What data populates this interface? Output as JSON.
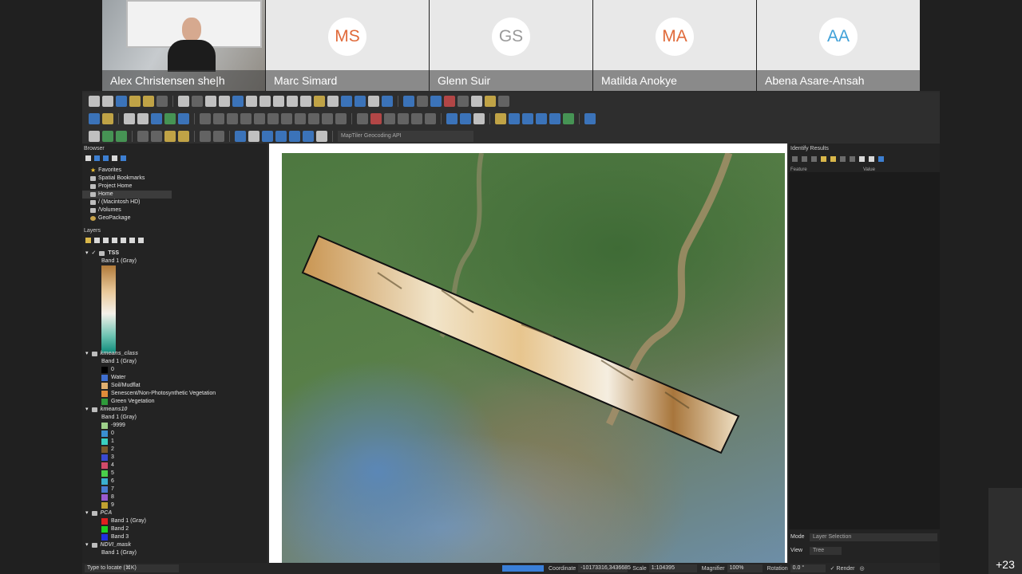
{
  "participants": [
    {
      "name": "Alex Christensen she|h",
      "initials": "",
      "video": true,
      "color": "#ffffff"
    },
    {
      "name": "Marc Simard",
      "initials": "MS",
      "video": false,
      "color": "#e06a3a"
    },
    {
      "name": "Glenn Suir",
      "initials": "GS",
      "video": false,
      "color": "#9a9a9a"
    },
    {
      "name": "Matilda Anokye",
      "initials": "MA",
      "video": false,
      "color": "#e06a3a"
    },
    {
      "name": "Abena Asare-Ansah",
      "initials": "AA",
      "video": false,
      "color": "#3ea0d8"
    }
  ],
  "more_participants": "+23",
  "toolbar": {
    "geocoding_placeholder": "MapTiler Geocoding API"
  },
  "browser": {
    "title": "Browser",
    "items": [
      "Favorites",
      "Spatial Bookmarks",
      "Project Home",
      "Home",
      "/ (Macintosh HD)",
      "/Volumes",
      "GeoPackage"
    ],
    "selected": "Home"
  },
  "layers": {
    "title": "Layers",
    "tss": {
      "name": "TSS",
      "band": "Band 1 (Gray)"
    },
    "kmeans_class": {
      "name": "kmeans_class",
      "band": "Band 1 (Gray)",
      "classes": [
        {
          "label": "0",
          "color": "#000000"
        },
        {
          "label": "Water",
          "color": "#3f6fd0"
        },
        {
          "label": "Soil/Mudflat",
          "color": "#e0b070"
        },
        {
          "label": "Senescent/Non-Photosynthetic Vegetation",
          "color": "#e08c3a"
        },
        {
          "label": "Green Vegetation",
          "color": "#2e9a3a"
        }
      ]
    },
    "kmeans10": {
      "name": "kmeans10",
      "band": "Band 1 (Gray)",
      "classes": [
        {
          "label": "-9999",
          "color": "#9ed08a"
        },
        {
          "label": "0",
          "color": "#3a8fd0"
        },
        {
          "label": "1",
          "color": "#3ad0c0"
        },
        {
          "label": "2",
          "color": "#7a5a2a"
        },
        {
          "label": "3",
          "color": "#3a4ad0"
        },
        {
          "label": "4",
          "color": "#d04a6a"
        },
        {
          "label": "5",
          "color": "#4ad04a"
        },
        {
          "label": "6",
          "color": "#3ab0d0"
        },
        {
          "label": "7",
          "color": "#4a7ad0"
        },
        {
          "label": "8",
          "color": "#9a5ad0"
        },
        {
          "label": "9",
          "color": "#c0a030"
        }
      ]
    },
    "pca": {
      "name": "PCA",
      "bands": [
        {
          "label": "Band 1 (Gray)",
          "color": "#e02020"
        },
        {
          "label": "Band 2",
          "color": "#20d020"
        },
        {
          "label": "Band 3",
          "color": "#2030e0"
        }
      ]
    },
    "ndvi_mask": {
      "name": "NDVI_mask",
      "band": "Band 1 (Gray)"
    }
  },
  "identify": {
    "title": "Identify Results",
    "col_feature": "Feature",
    "col_value": "Value",
    "mode_label": "Mode",
    "mode_value": "Layer Selection",
    "view_label": "View",
    "view_value": "Tree"
  },
  "statusbar": {
    "locate_placeholder": "Type to locate (⌘K)",
    "coordinate_label": "Coordinate",
    "coordinate_value": "-10173316,3436685",
    "scale_label": "Scale",
    "scale_value": "1:104395",
    "magnifier_label": "Magnifier",
    "magnifier_value": "100%",
    "rotation_label": "Rotation",
    "rotation_value": "0.0 °",
    "render_label": "Render"
  }
}
